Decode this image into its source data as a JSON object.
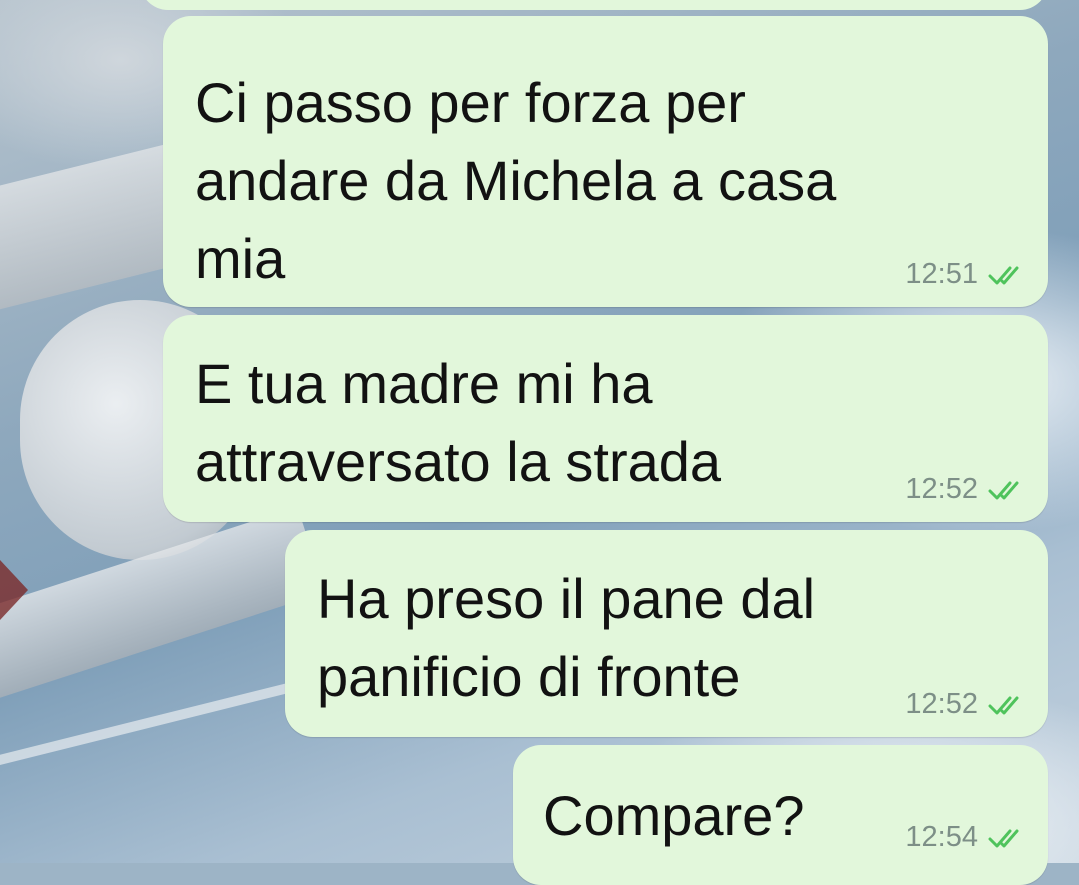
{
  "messages": [
    {
      "lines": [
        "Ci passo per forza per",
        "andare da Michela a casa",
        "mia"
      ],
      "time": "12:51",
      "status": "read"
    },
    {
      "lines": [
        "E tua madre mi ha",
        "attraversato la strada"
      ],
      "time": "12:52",
      "status": "read"
    },
    {
      "lines": [
        "Ha preso il pane dal",
        "panificio di fronte"
      ],
      "time": "12:52",
      "status": "read"
    },
    {
      "lines": [
        "Compare?"
      ],
      "time": "12:54",
      "status": "read"
    }
  ],
  "colors": {
    "bubble_outgoing": "#e2f7db",
    "text": "#121212",
    "timestamp": "#7d8f87",
    "read_ticks": "#4fc35c"
  },
  "icons": {
    "read_status": "double-check-icon"
  }
}
